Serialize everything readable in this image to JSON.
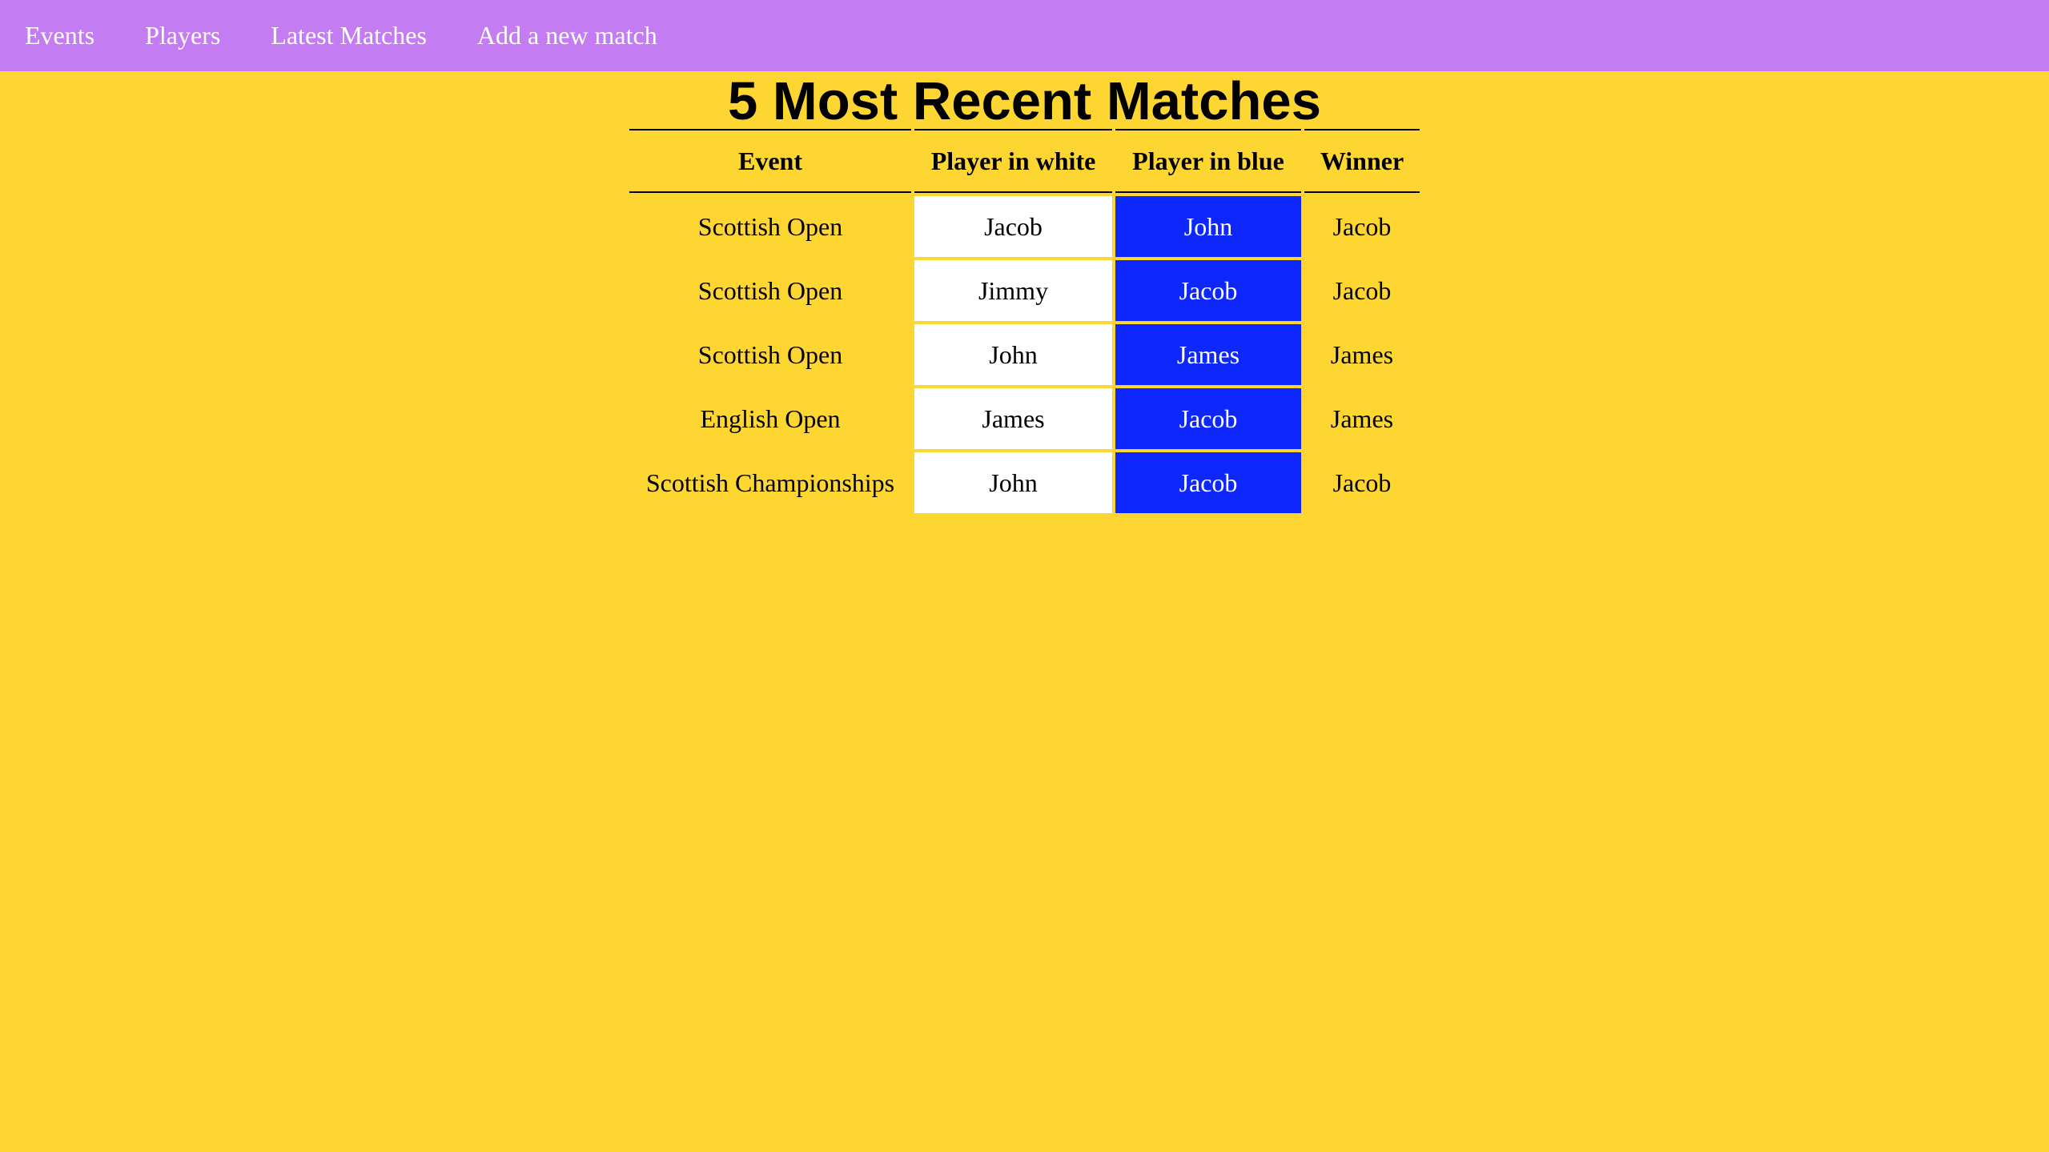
{
  "nav": {
    "items": [
      {
        "label": "Events"
      },
      {
        "label": "Players"
      },
      {
        "label": "Latest Matches"
      },
      {
        "label": "Add a new match"
      }
    ]
  },
  "page": {
    "title": "5 Most Recent Matches"
  },
  "table": {
    "headers": {
      "event": "Event",
      "white": "Player in white",
      "blue": "Player in blue",
      "winner": "Winner"
    },
    "rows": [
      {
        "event": "Scottish Open",
        "white": "Jacob",
        "blue": "John",
        "winner": "Jacob"
      },
      {
        "event": "Scottish Open",
        "white": "Jimmy",
        "blue": "Jacob",
        "winner": "Jacob"
      },
      {
        "event": "Scottish Open",
        "white": "John",
        "blue": "James",
        "winner": "James"
      },
      {
        "event": "English Open",
        "white": "James",
        "blue": "Jacob",
        "winner": "James"
      },
      {
        "event": "Scottish Championships",
        "white": "John",
        "blue": "Jacob",
        "winner": "Jacob"
      }
    ]
  },
  "colors": {
    "background": "#fed631",
    "navbar": "#c47cf2",
    "white_cell": "#ffffff",
    "blue_cell": "#0d27fc"
  }
}
